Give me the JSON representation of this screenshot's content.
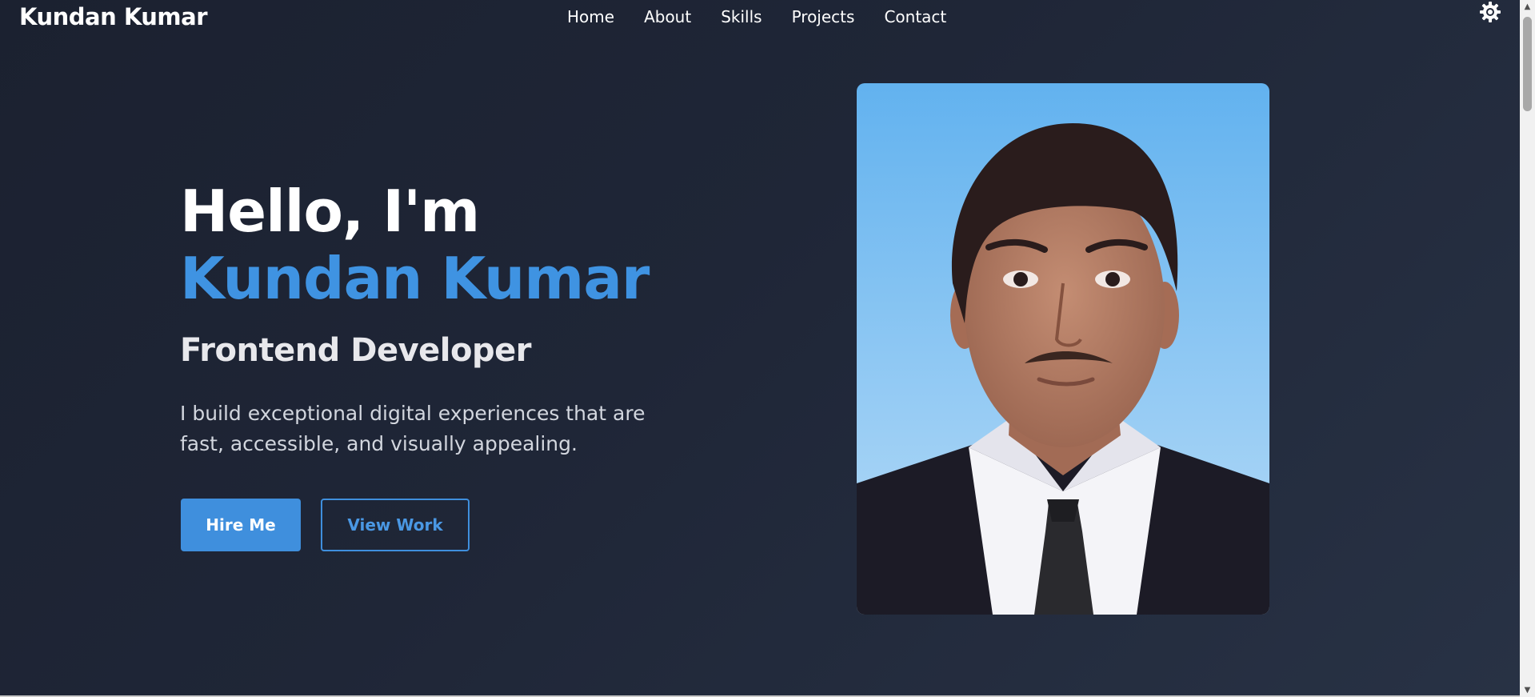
{
  "nav": {
    "brand": "Kundan Kumar",
    "links": [
      "Home",
      "About",
      "Skills",
      "Projects",
      "Contact"
    ],
    "theme_toggle_icon": "gear-icon"
  },
  "hero": {
    "greeting": "Hello, I'm",
    "name_first": "Kundan",
    "name_last": "Kumar",
    "role": "Frontend Developer",
    "description": "I build exceptional digital experiences that are fast, accessible, and visually appealing.",
    "primary_button": "Hire Me",
    "secondary_button": "View Work"
  },
  "colors": {
    "accent": "#3f93e2",
    "background": "#1f2637",
    "photo_sky": "#6ab4ef"
  },
  "scrollbar": {
    "up_icon": "arrow-up-icon",
    "down_icon": "arrow-down-icon"
  }
}
